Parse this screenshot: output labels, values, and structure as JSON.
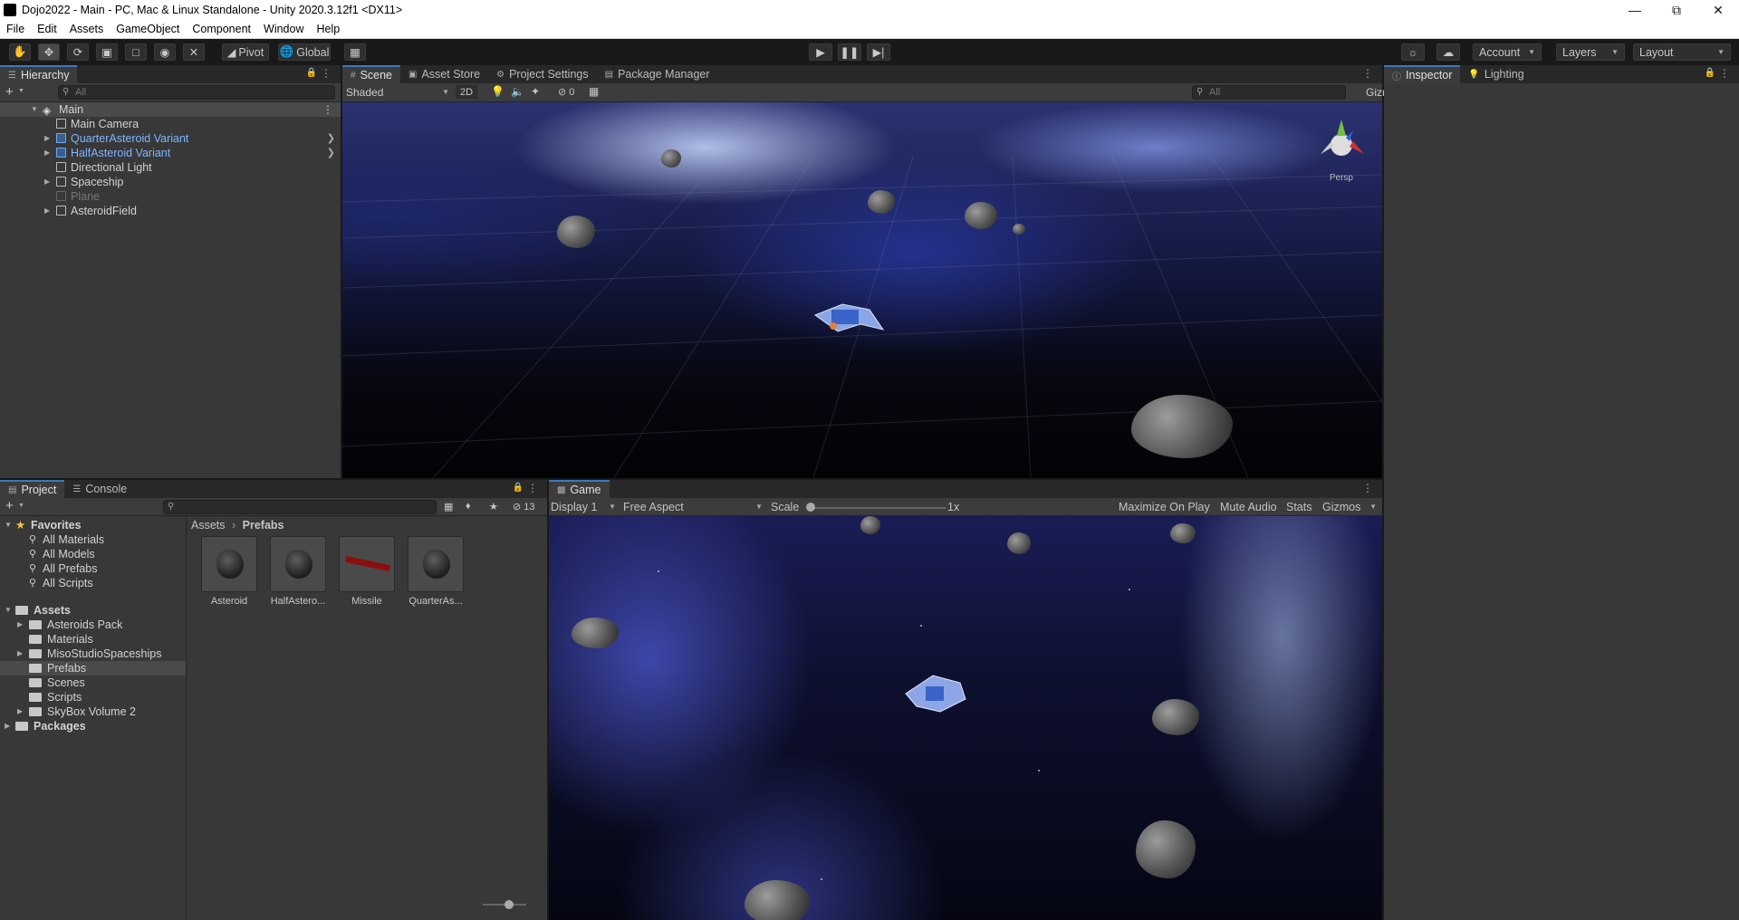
{
  "window": {
    "title": "Dojo2022 - Main - PC, Mac & Linux Standalone - Unity 2020.3.12f1 <DX11>"
  },
  "menu": [
    "File",
    "Edit",
    "Assets",
    "GameObject",
    "Component",
    "Window",
    "Help"
  ],
  "toolbar": {
    "pivot": "Pivot",
    "global": "Global",
    "account": "Account",
    "layers": "Layers",
    "layout": "Layout"
  },
  "hierarchy": {
    "tab": "Hierarchy",
    "search_placeholder": "All",
    "scene": "Main",
    "items": [
      {
        "label": "Main Camera"
      },
      {
        "label": "QuarterAsteroid Variant"
      },
      {
        "label": "HalfAsteroid Variant"
      },
      {
        "label": "Directional Light"
      },
      {
        "label": "Spaceship"
      },
      {
        "label": "Plane"
      },
      {
        "label": "AsteroidField"
      }
    ]
  },
  "scene": {
    "tabs": [
      "Scene",
      "Asset Store",
      "Project Settings",
      "Package Manager"
    ],
    "shading": "Shaded",
    "mode2d": "2D",
    "hidden_count": "0",
    "gizmos": "Gizmos",
    "search_placeholder": "All",
    "persp": "Persp"
  },
  "inspector": {
    "tabs": [
      "Inspector",
      "Lighting"
    ]
  },
  "project": {
    "tabs": [
      "Project",
      "Console"
    ],
    "count": "13",
    "breadcrumb": [
      "Assets",
      "Prefabs"
    ],
    "favorites": {
      "label": "Favorites",
      "items": [
        "All Materials",
        "All Models",
        "All Prefabs",
        "All Scripts"
      ]
    },
    "assets": {
      "label": "Assets",
      "items": [
        "Asteroids Pack",
        "Materials",
        "MisoStudioSpaceships",
        "Prefabs",
        "Scenes",
        "Scripts",
        "SkyBox Volume 2"
      ]
    },
    "packages": "Packages",
    "files": [
      "Asteroid",
      "HalfAstero...",
      "Missile",
      "QuarterAs..."
    ]
  },
  "game": {
    "tab": "Game",
    "display": "Display 1",
    "aspect": "Free Aspect",
    "scale_label": "Scale",
    "scale_value": "1x",
    "maximize": "Maximize On Play",
    "mute": "Mute Audio",
    "stats": "Stats",
    "gizmos": "Gizmos"
  }
}
